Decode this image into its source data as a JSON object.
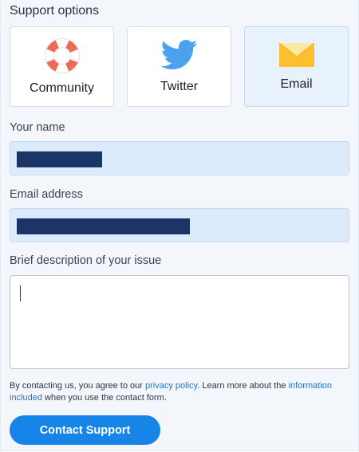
{
  "support": {
    "title": "Support options",
    "options": [
      {
        "label": "Community",
        "icon": "lifebuoy-icon",
        "selected": false
      },
      {
        "label": "Twitter",
        "icon": "twitter-bird-icon",
        "selected": false
      },
      {
        "label": "Email",
        "icon": "envelope-icon",
        "selected": true
      }
    ]
  },
  "form": {
    "name_label": "Your name",
    "email_label": "Email address",
    "description_label": "Brief description of your issue",
    "description_value": ""
  },
  "disclaimer": {
    "part1": "By contacting us, you agree to our ",
    "privacy_link": "privacy policy",
    "part2": ". Learn more about the ",
    "info_link": "information included",
    "part3": " when you use the contact form."
  },
  "submit_label": "Contact Support",
  "colors": {
    "accent": "#1784e8",
    "field_fill": "#dcebfb",
    "redaction": "#1b3568",
    "selected_option": "#e8f2fd"
  }
}
